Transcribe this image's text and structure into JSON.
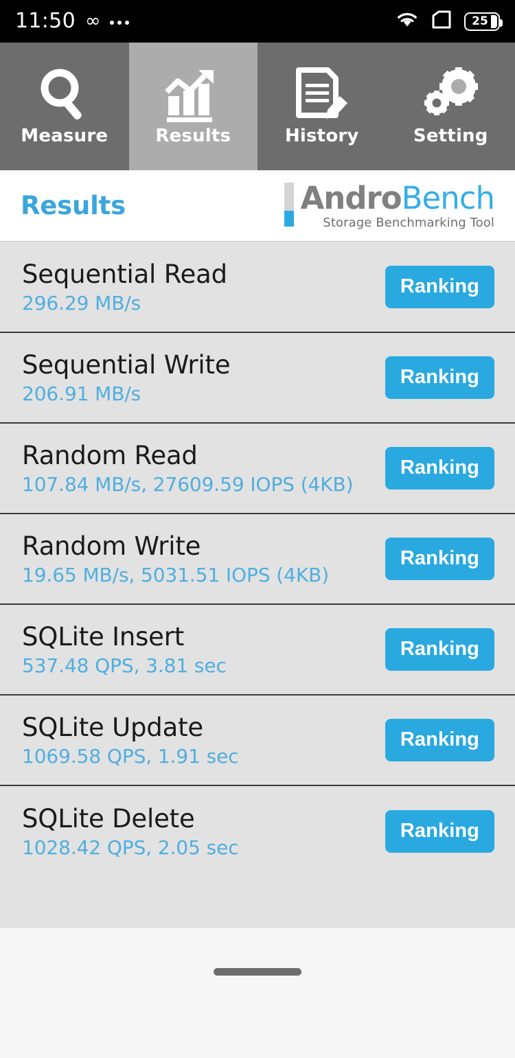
{
  "statusbar": {
    "time": "11:50",
    "infinity_icon": "infinity-icon",
    "overflow_icon": "more-dots-icon",
    "wifi_icon": "wifi-icon",
    "sim_icon": "sim-card-icon",
    "battery_icon": "battery-icon",
    "battery_level": "25"
  },
  "tabs": [
    {
      "label": "Measure",
      "icon": "magnifier-icon",
      "active": false
    },
    {
      "label": "Results",
      "icon": "bar-chart-trend-icon",
      "active": true
    },
    {
      "label": "History",
      "icon": "document-pencil-icon",
      "active": false
    },
    {
      "label": "Setting",
      "icon": "gears-icon",
      "active": false
    }
  ],
  "header": {
    "title": "Results",
    "logo": {
      "name_part1": "Andro",
      "name_part2": "Bench",
      "tagline": "Storage Benchmarking Tool"
    }
  },
  "results": {
    "ranking_label": "Ranking",
    "rows": [
      {
        "title": "Sequential Read",
        "value": "296.29 MB/s"
      },
      {
        "title": "Sequential Write",
        "value": "206.91 MB/s"
      },
      {
        "title": "Random Read",
        "value": "107.84 MB/s, 27609.59 IOPS (4KB)"
      },
      {
        "title": "Random Write",
        "value": "19.65 MB/s, 5031.51 IOPS (4KB)"
      },
      {
        "title": "SQLite Insert",
        "value": "537.48 QPS, 3.81 sec"
      },
      {
        "title": "SQLite Update",
        "value": "1069.58 QPS, 1.91 sec"
      },
      {
        "title": "SQLite Delete",
        "value": "1028.42 QPS, 2.05 sec"
      }
    ]
  },
  "navigation": {
    "gesture_handle": "home-gesture-pill"
  },
  "colors": {
    "accent_blue": "#29A9E0",
    "title_blue": "#3AA6DC",
    "value_blue": "#4FAEE0",
    "tab_inactive": "#6D6D6D",
    "tab_active": "#ACACAC",
    "list_bg": "#E2E2E2",
    "statusbar_bg": "#000000"
  }
}
